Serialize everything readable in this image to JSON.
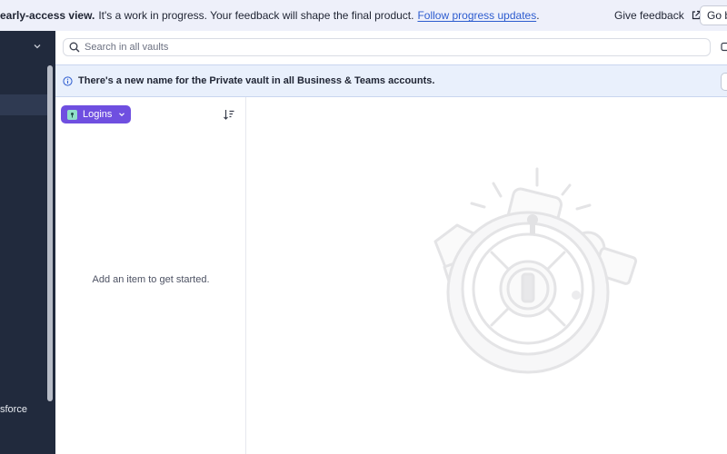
{
  "banner": {
    "bold": "early-access view.",
    "message": "It's a work in progress. Your feedback will shape the final product.",
    "link": "Follow progress updates",
    "punct": ".",
    "feedback_label": "Give feedback",
    "go_back_label": "Go ba"
  },
  "sidebar": {
    "item_text": "sforce"
  },
  "search": {
    "placeholder": "Search in all vaults"
  },
  "notice": {
    "text": "There's a new name for the Private vault in all Business & Teams accounts."
  },
  "list": {
    "category_label": "Logins",
    "empty_message": "Add an item to get started."
  },
  "colors": {
    "accent": "#6f4fe0",
    "sidebar": "#212a3d",
    "link": "#2d5ccf",
    "notice_bg": "#e9f0fc"
  }
}
